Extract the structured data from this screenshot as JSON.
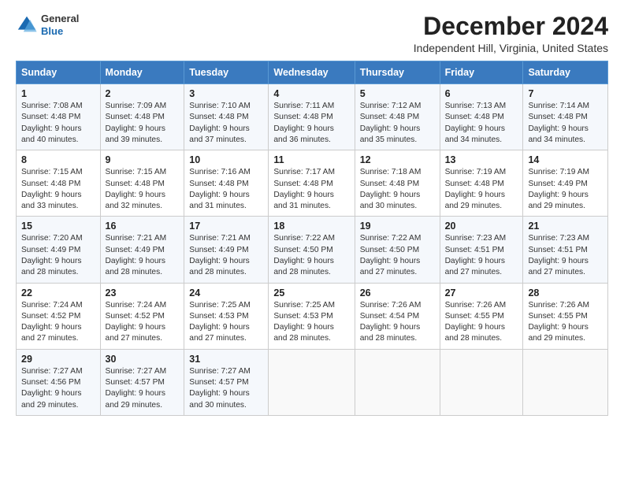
{
  "header": {
    "logo_line1": "General",
    "logo_line2": "Blue",
    "month": "December 2024",
    "location": "Independent Hill, Virginia, United States"
  },
  "weekdays": [
    "Sunday",
    "Monday",
    "Tuesday",
    "Wednesday",
    "Thursday",
    "Friday",
    "Saturday"
  ],
  "weeks": [
    [
      {
        "day": "1",
        "details": "Sunrise: 7:08 AM\nSunset: 4:48 PM\nDaylight: 9 hours\nand 40 minutes."
      },
      {
        "day": "2",
        "details": "Sunrise: 7:09 AM\nSunset: 4:48 PM\nDaylight: 9 hours\nand 39 minutes."
      },
      {
        "day": "3",
        "details": "Sunrise: 7:10 AM\nSunset: 4:48 PM\nDaylight: 9 hours\nand 37 minutes."
      },
      {
        "day": "4",
        "details": "Sunrise: 7:11 AM\nSunset: 4:48 PM\nDaylight: 9 hours\nand 36 minutes."
      },
      {
        "day": "5",
        "details": "Sunrise: 7:12 AM\nSunset: 4:48 PM\nDaylight: 9 hours\nand 35 minutes."
      },
      {
        "day": "6",
        "details": "Sunrise: 7:13 AM\nSunset: 4:48 PM\nDaylight: 9 hours\nand 34 minutes."
      },
      {
        "day": "7",
        "details": "Sunrise: 7:14 AM\nSunset: 4:48 PM\nDaylight: 9 hours\nand 34 minutes."
      }
    ],
    [
      {
        "day": "8",
        "details": "Sunrise: 7:15 AM\nSunset: 4:48 PM\nDaylight: 9 hours\nand 33 minutes."
      },
      {
        "day": "9",
        "details": "Sunrise: 7:15 AM\nSunset: 4:48 PM\nDaylight: 9 hours\nand 32 minutes."
      },
      {
        "day": "10",
        "details": "Sunrise: 7:16 AM\nSunset: 4:48 PM\nDaylight: 9 hours\nand 31 minutes."
      },
      {
        "day": "11",
        "details": "Sunrise: 7:17 AM\nSunset: 4:48 PM\nDaylight: 9 hours\nand 31 minutes."
      },
      {
        "day": "12",
        "details": "Sunrise: 7:18 AM\nSunset: 4:48 PM\nDaylight: 9 hours\nand 30 minutes."
      },
      {
        "day": "13",
        "details": "Sunrise: 7:19 AM\nSunset: 4:48 PM\nDaylight: 9 hours\nand 29 minutes."
      },
      {
        "day": "14",
        "details": "Sunrise: 7:19 AM\nSunset: 4:49 PM\nDaylight: 9 hours\nand 29 minutes."
      }
    ],
    [
      {
        "day": "15",
        "details": "Sunrise: 7:20 AM\nSunset: 4:49 PM\nDaylight: 9 hours\nand 28 minutes."
      },
      {
        "day": "16",
        "details": "Sunrise: 7:21 AM\nSunset: 4:49 PM\nDaylight: 9 hours\nand 28 minutes."
      },
      {
        "day": "17",
        "details": "Sunrise: 7:21 AM\nSunset: 4:49 PM\nDaylight: 9 hours\nand 28 minutes."
      },
      {
        "day": "18",
        "details": "Sunrise: 7:22 AM\nSunset: 4:50 PM\nDaylight: 9 hours\nand 28 minutes."
      },
      {
        "day": "19",
        "details": "Sunrise: 7:22 AM\nSunset: 4:50 PM\nDaylight: 9 hours\nand 27 minutes."
      },
      {
        "day": "20",
        "details": "Sunrise: 7:23 AM\nSunset: 4:51 PM\nDaylight: 9 hours\nand 27 minutes."
      },
      {
        "day": "21",
        "details": "Sunrise: 7:23 AM\nSunset: 4:51 PM\nDaylight: 9 hours\nand 27 minutes."
      }
    ],
    [
      {
        "day": "22",
        "details": "Sunrise: 7:24 AM\nSunset: 4:52 PM\nDaylight: 9 hours\nand 27 minutes."
      },
      {
        "day": "23",
        "details": "Sunrise: 7:24 AM\nSunset: 4:52 PM\nDaylight: 9 hours\nand 27 minutes."
      },
      {
        "day": "24",
        "details": "Sunrise: 7:25 AM\nSunset: 4:53 PM\nDaylight: 9 hours\nand 27 minutes."
      },
      {
        "day": "25",
        "details": "Sunrise: 7:25 AM\nSunset: 4:53 PM\nDaylight: 9 hours\nand 28 minutes."
      },
      {
        "day": "26",
        "details": "Sunrise: 7:26 AM\nSunset: 4:54 PM\nDaylight: 9 hours\nand 28 minutes."
      },
      {
        "day": "27",
        "details": "Sunrise: 7:26 AM\nSunset: 4:55 PM\nDaylight: 9 hours\nand 28 minutes."
      },
      {
        "day": "28",
        "details": "Sunrise: 7:26 AM\nSunset: 4:55 PM\nDaylight: 9 hours\nand 29 minutes."
      }
    ],
    [
      {
        "day": "29",
        "details": "Sunrise: 7:27 AM\nSunset: 4:56 PM\nDaylight: 9 hours\nand 29 minutes."
      },
      {
        "day": "30",
        "details": "Sunrise: 7:27 AM\nSunset: 4:57 PM\nDaylight: 9 hours\nand 29 minutes."
      },
      {
        "day": "31",
        "details": "Sunrise: 7:27 AM\nSunset: 4:57 PM\nDaylight: 9 hours\nand 30 minutes."
      },
      {
        "day": "",
        "details": ""
      },
      {
        "day": "",
        "details": ""
      },
      {
        "day": "",
        "details": ""
      },
      {
        "day": "",
        "details": ""
      }
    ]
  ]
}
